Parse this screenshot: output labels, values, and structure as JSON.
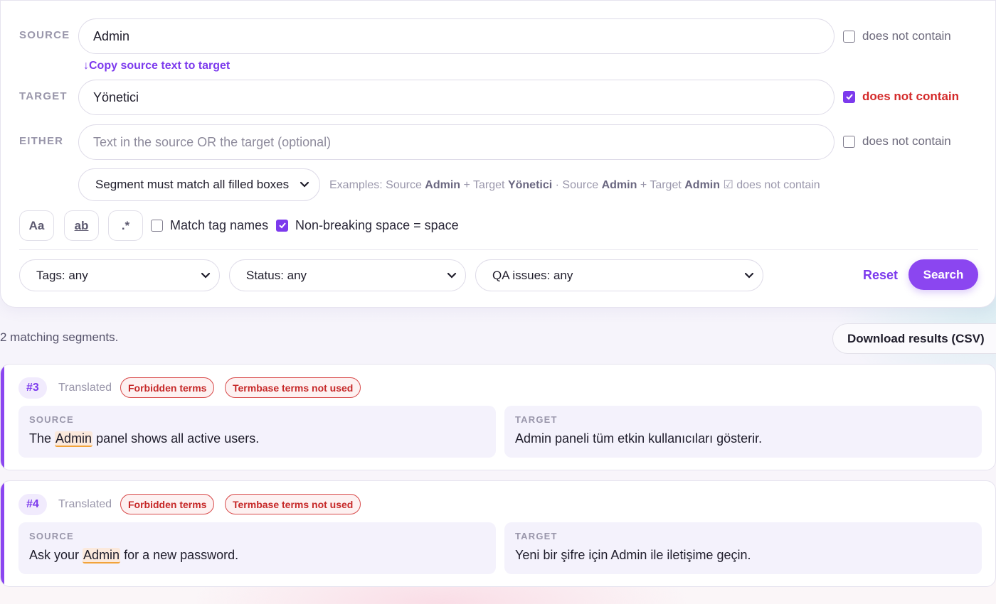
{
  "search": {
    "source": {
      "label": "SOURCE",
      "value": "Admin",
      "does_not_contain_label": "does not contain",
      "does_not_contain_checked": false
    },
    "copy_link": "↓Copy source text to target",
    "target": {
      "label": "TARGET",
      "value": "Yönetici",
      "does_not_contain_label": "does not contain",
      "does_not_contain_checked": true
    },
    "either": {
      "label": "EITHER",
      "value": "",
      "placeholder": "Text in the source OR the target (optional)",
      "does_not_contain_label": "does not contain",
      "does_not_contain_checked": false
    },
    "match_mode": "Segment must match all filled boxes",
    "examples": {
      "prefix": "Examples: Source",
      "ex1_source": "Admin",
      "plus_target_1": "+ Target",
      "ex1_target": "Yönetici",
      "sep": "·",
      "source_2": "Source",
      "ex2_source": "Admin",
      "plus_target_2": "+ Target",
      "ex2_target": "Admin",
      "ex2_suffix": "☑ does not contain"
    },
    "options": {
      "case_button": "Aa",
      "whole_word_button": "ab",
      "regex_button": ".*",
      "match_tag_names_label": "Match tag names",
      "match_tag_names_checked": false,
      "nbsp_label": "Non-breaking space = space",
      "nbsp_checked": true
    },
    "filters": {
      "tags": "Tags: any",
      "status": "Status: any",
      "qa": "QA issues: any"
    },
    "reset_label": "Reset",
    "search_label": "Search"
  },
  "results": {
    "count_text": "2 matching segments.",
    "download_label": "Download results (CSV)",
    "source_label": "SOURCE",
    "target_label": "TARGET",
    "segments": [
      {
        "id": "#3",
        "status": "Translated",
        "badges": [
          "Forbidden terms",
          "Termbase terms not used"
        ],
        "source_before": "The",
        "source_match": "Admin",
        "source_after": "panel shows all active users.",
        "target": "Admin paneli tüm etkin kullanıcıları gösterir."
      },
      {
        "id": "#4",
        "status": "Translated",
        "badges": [
          "Forbidden terms",
          "Termbase terms not used"
        ],
        "source_before": "Ask your",
        "source_match": "Admin",
        "source_after": "for a new password.",
        "target": "Yeni bir şifre için Admin ile iletişime geçin."
      }
    ]
  },
  "colors": {
    "accent": "#7c3aed",
    "danger": "#d42a2a",
    "highlight": "#fbe9dc"
  },
  "icons": {
    "checkbox_check": "checkmark-icon",
    "select_chevron": "chevron-down-icon"
  }
}
